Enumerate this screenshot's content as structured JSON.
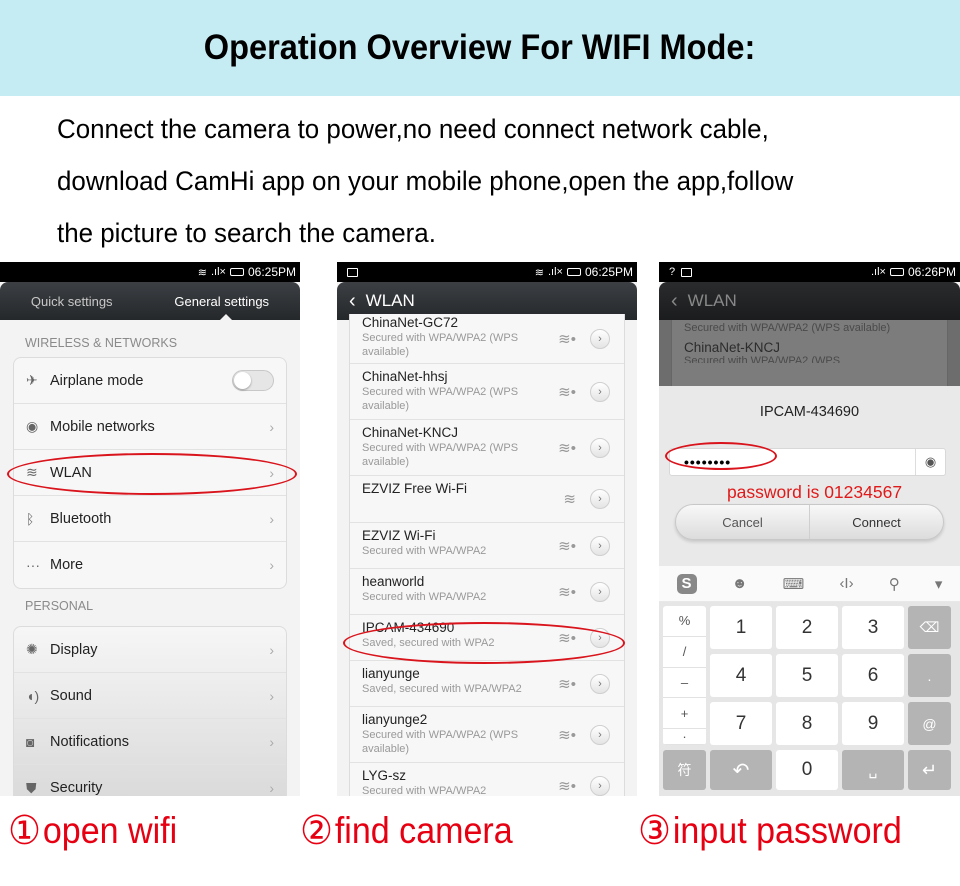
{
  "header": {
    "title": "Operation Overview For WIFI Mode:"
  },
  "intro": {
    "lines": [
      "Connect the camera to power,no need connect network cable,",
      "download CamHi app on your mobile phone,open the app,follow",
      "the picture to search the camera."
    ]
  },
  "accent_color": "#e60012",
  "screen1": {
    "status_time": "06:25PM",
    "tabs": [
      "Quick settings",
      "General settings"
    ],
    "active_tab": "General settings",
    "sections": [
      {
        "label": "WIRELESS & NETWORKS",
        "items": [
          {
            "icon": "airplane-icon",
            "glyph": "✈",
            "label": "Airplane mode",
            "control": "toggle",
            "toggle_on": false
          },
          {
            "icon": "mobile-networks-icon",
            "glyph": "◉",
            "label": "Mobile networks",
            "control": "chevron"
          },
          {
            "icon": "wifi-icon",
            "glyph": "≋",
            "label": "WLAN",
            "control": "chevron",
            "highlighted": true
          },
          {
            "icon": "bluetooth-icon",
            "glyph": "ᛒ",
            "label": "Bluetooth",
            "control": "chevron"
          },
          {
            "icon": "more-icon",
            "glyph": "···",
            "label": "More",
            "control": "chevron"
          }
        ]
      },
      {
        "label": "PERSONAL",
        "items": [
          {
            "icon": "display-icon",
            "glyph": "✺",
            "label": "Display",
            "control": "chevron"
          },
          {
            "icon": "sound-icon",
            "glyph": "◖)",
            "label": "Sound",
            "control": "chevron"
          },
          {
            "icon": "notifications-icon",
            "glyph": "◙",
            "label": "Notifications",
            "control": "chevron"
          },
          {
            "icon": "security-icon",
            "glyph": "⛊",
            "label": "Security",
            "control": "chevron"
          }
        ]
      }
    ],
    "chevron": "›"
  },
  "screen2": {
    "status_time": "06:25PM",
    "title": "WLAN",
    "back": "‹",
    "networks": [
      {
        "name": "ChinaNet-GC72",
        "sub": "Secured with WPA/WPA2 (WPS available)",
        "locked": true
      },
      {
        "name": "ChinaNet-hhsj",
        "sub": "Secured with WPA/WPA2 (WPS available)",
        "locked": true
      },
      {
        "name": "ChinaNet-KNCJ",
        "sub": "Secured with WPA/WPA2 (WPS available)",
        "locked": true
      },
      {
        "name": "EZVIZ Free Wi-Fi",
        "sub": "",
        "locked": false
      },
      {
        "name": "EZVIZ Wi-Fi",
        "sub": "Secured with WPA/WPA2",
        "locked": true
      },
      {
        "name": "heanworld",
        "sub": "Secured with WPA/WPA2",
        "locked": true
      },
      {
        "name": "IPCAM-434690",
        "sub": "Saved, secured with WPA2",
        "locked": true,
        "highlighted": true
      },
      {
        "name": "lianyunge",
        "sub": "Saved, secured with WPA/WPA2",
        "locked": true
      },
      {
        "name": "lianyunge2",
        "sub": "Secured with WPA/WPA2 (WPS available)",
        "locked": true
      },
      {
        "name": "LYG-sz",
        "sub": "Secured with WPA/WPA2",
        "locked": true
      }
    ]
  },
  "screen3": {
    "status_time": "06:26PM",
    "title": "WLAN",
    "back": "‹",
    "bg_networks": [
      {
        "name": "",
        "sub": "Secured with WPA/WPA2 (WPS available)"
      },
      {
        "name": "ChinaNet-KNCJ",
        "sub": "Secured with WPA/WPA2 (WPS"
      }
    ],
    "dialog": {
      "title": "IPCAM-434690",
      "password_value": "••••••••",
      "hint": "password is 01234567",
      "cancel": "Cancel",
      "connect": "Connect"
    },
    "keyboard": {
      "tools": [
        "S",
        "☻",
        "⌨",
        "‹I›",
        "⚲",
        "▾"
      ],
      "symbols": [
        "%",
        "/",
        "–",
        "+",
        "·"
      ],
      "digits": [
        "1",
        "2",
        "3",
        "4",
        "5",
        "6",
        "7",
        "8",
        "9"
      ],
      "right_keys": [
        "⌫",
        ".",
        "@"
      ],
      "bottom": {
        "sym": "符",
        "back": "↶",
        "zero": "0",
        "space": "␣",
        "enter": "↵"
      }
    }
  },
  "steps": [
    {
      "num": "①",
      "label": "open wifi"
    },
    {
      "num": "②",
      "label": "find camera"
    },
    {
      "num": "③",
      "label": "input password"
    }
  ]
}
